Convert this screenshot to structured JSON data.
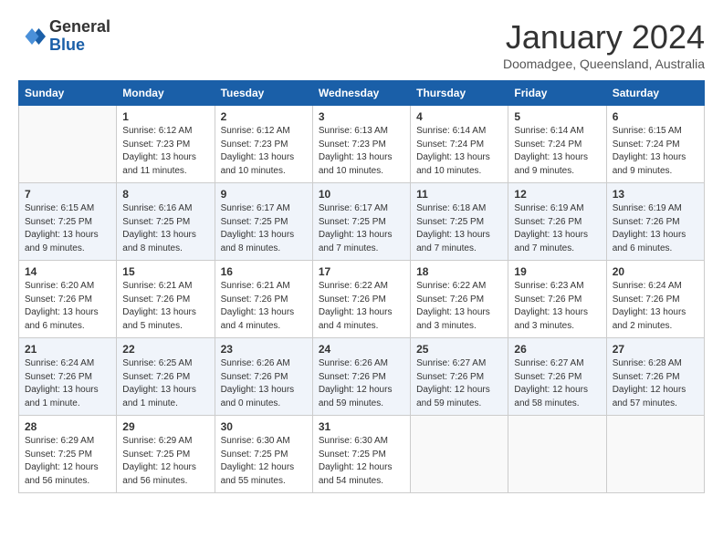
{
  "header": {
    "logo_general": "General",
    "logo_blue": "Blue",
    "month": "January 2024",
    "location": "Doomadgee, Queensland, Australia"
  },
  "days_of_week": [
    "Sunday",
    "Monday",
    "Tuesday",
    "Wednesday",
    "Thursday",
    "Friday",
    "Saturday"
  ],
  "weeks": [
    [
      {
        "day": "",
        "info": ""
      },
      {
        "day": "1",
        "info": "Sunrise: 6:12 AM\nSunset: 7:23 PM\nDaylight: 13 hours\nand 11 minutes."
      },
      {
        "day": "2",
        "info": "Sunrise: 6:12 AM\nSunset: 7:23 PM\nDaylight: 13 hours\nand 10 minutes."
      },
      {
        "day": "3",
        "info": "Sunrise: 6:13 AM\nSunset: 7:23 PM\nDaylight: 13 hours\nand 10 minutes."
      },
      {
        "day": "4",
        "info": "Sunrise: 6:14 AM\nSunset: 7:24 PM\nDaylight: 13 hours\nand 10 minutes."
      },
      {
        "day": "5",
        "info": "Sunrise: 6:14 AM\nSunset: 7:24 PM\nDaylight: 13 hours\nand 9 minutes."
      },
      {
        "day": "6",
        "info": "Sunrise: 6:15 AM\nSunset: 7:24 PM\nDaylight: 13 hours\nand 9 minutes."
      }
    ],
    [
      {
        "day": "7",
        "info": "Sunrise: 6:15 AM\nSunset: 7:25 PM\nDaylight: 13 hours\nand 9 minutes."
      },
      {
        "day": "8",
        "info": "Sunrise: 6:16 AM\nSunset: 7:25 PM\nDaylight: 13 hours\nand 8 minutes."
      },
      {
        "day": "9",
        "info": "Sunrise: 6:17 AM\nSunset: 7:25 PM\nDaylight: 13 hours\nand 8 minutes."
      },
      {
        "day": "10",
        "info": "Sunrise: 6:17 AM\nSunset: 7:25 PM\nDaylight: 13 hours\nand 7 minutes."
      },
      {
        "day": "11",
        "info": "Sunrise: 6:18 AM\nSunset: 7:25 PM\nDaylight: 13 hours\nand 7 minutes."
      },
      {
        "day": "12",
        "info": "Sunrise: 6:19 AM\nSunset: 7:26 PM\nDaylight: 13 hours\nand 7 minutes."
      },
      {
        "day": "13",
        "info": "Sunrise: 6:19 AM\nSunset: 7:26 PM\nDaylight: 13 hours\nand 6 minutes."
      }
    ],
    [
      {
        "day": "14",
        "info": "Sunrise: 6:20 AM\nSunset: 7:26 PM\nDaylight: 13 hours\nand 6 minutes."
      },
      {
        "day": "15",
        "info": "Sunrise: 6:21 AM\nSunset: 7:26 PM\nDaylight: 13 hours\nand 5 minutes."
      },
      {
        "day": "16",
        "info": "Sunrise: 6:21 AM\nSunset: 7:26 PM\nDaylight: 13 hours\nand 4 minutes."
      },
      {
        "day": "17",
        "info": "Sunrise: 6:22 AM\nSunset: 7:26 PM\nDaylight: 13 hours\nand 4 minutes."
      },
      {
        "day": "18",
        "info": "Sunrise: 6:22 AM\nSunset: 7:26 PM\nDaylight: 13 hours\nand 3 minutes."
      },
      {
        "day": "19",
        "info": "Sunrise: 6:23 AM\nSunset: 7:26 PM\nDaylight: 13 hours\nand 3 minutes."
      },
      {
        "day": "20",
        "info": "Sunrise: 6:24 AM\nSunset: 7:26 PM\nDaylight: 13 hours\nand 2 minutes."
      }
    ],
    [
      {
        "day": "21",
        "info": "Sunrise: 6:24 AM\nSunset: 7:26 PM\nDaylight: 13 hours\nand 1 minute."
      },
      {
        "day": "22",
        "info": "Sunrise: 6:25 AM\nSunset: 7:26 PM\nDaylight: 13 hours\nand 1 minute."
      },
      {
        "day": "23",
        "info": "Sunrise: 6:26 AM\nSunset: 7:26 PM\nDaylight: 13 hours\nand 0 minutes."
      },
      {
        "day": "24",
        "info": "Sunrise: 6:26 AM\nSunset: 7:26 PM\nDaylight: 12 hours\nand 59 minutes."
      },
      {
        "day": "25",
        "info": "Sunrise: 6:27 AM\nSunset: 7:26 PM\nDaylight: 12 hours\nand 59 minutes."
      },
      {
        "day": "26",
        "info": "Sunrise: 6:27 AM\nSunset: 7:26 PM\nDaylight: 12 hours\nand 58 minutes."
      },
      {
        "day": "27",
        "info": "Sunrise: 6:28 AM\nSunset: 7:26 PM\nDaylight: 12 hours\nand 57 minutes."
      }
    ],
    [
      {
        "day": "28",
        "info": "Sunrise: 6:29 AM\nSunset: 7:25 PM\nDaylight: 12 hours\nand 56 minutes."
      },
      {
        "day": "29",
        "info": "Sunrise: 6:29 AM\nSunset: 7:25 PM\nDaylight: 12 hours\nand 56 minutes."
      },
      {
        "day": "30",
        "info": "Sunrise: 6:30 AM\nSunset: 7:25 PM\nDaylight: 12 hours\nand 55 minutes."
      },
      {
        "day": "31",
        "info": "Sunrise: 6:30 AM\nSunset: 7:25 PM\nDaylight: 12 hours\nand 54 minutes."
      },
      {
        "day": "",
        "info": ""
      },
      {
        "day": "",
        "info": ""
      },
      {
        "day": "",
        "info": ""
      }
    ]
  ]
}
